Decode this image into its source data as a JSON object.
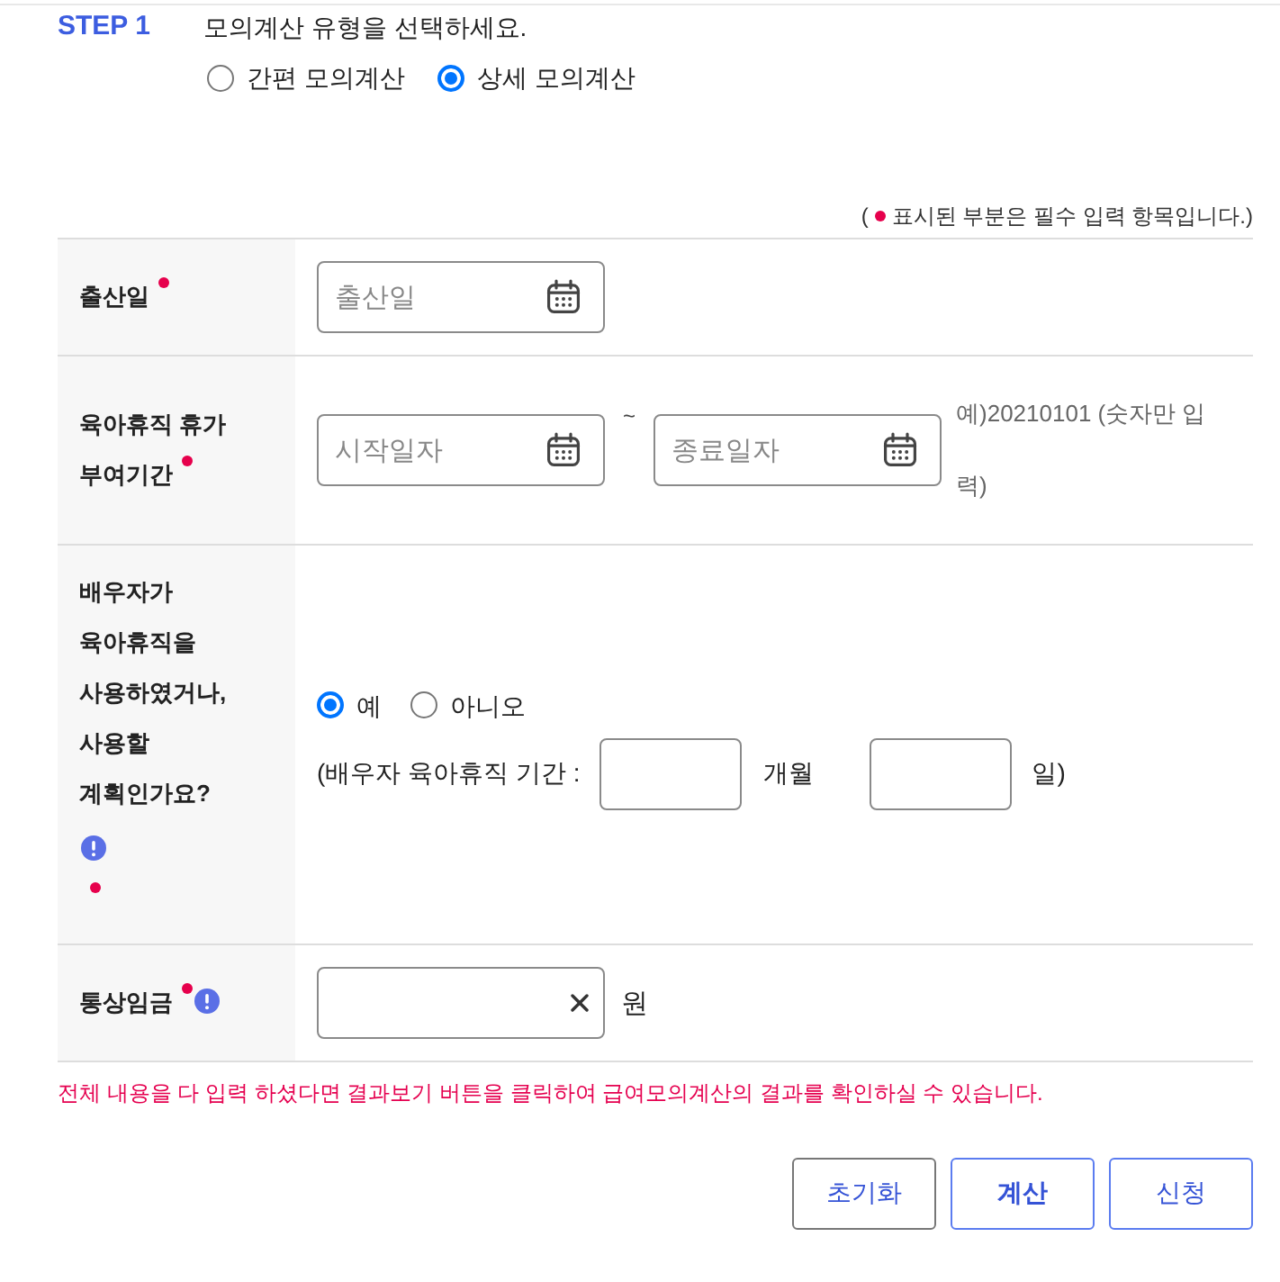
{
  "step": {
    "label": "STEP 1",
    "instruction": "모의계산 유형을 선택하세요.",
    "options": [
      {
        "label": "간편 모의계산",
        "selected": false
      },
      {
        "label": "상세 모의계산",
        "selected": true
      }
    ]
  },
  "required_note": {
    "open": "(",
    "text": "표시된 부분은 필수 입력 항목입니다.)"
  },
  "fields": [
    {
      "kind": "date",
      "label": "출산일",
      "required": true,
      "info": false,
      "placeholder": "출산일"
    },
    {
      "kind": "date_range",
      "label": "육아휴직 휴가 부여기간",
      "required": true,
      "info": false,
      "start": {
        "placeholder": "시작일자"
      },
      "separator": "~",
      "end": {
        "placeholder": "종료일자"
      },
      "hint": "예)20210101 (숫자만 입력)"
    },
    {
      "kind": "choice_period",
      "label": "배우자가 육아휴직을 사용하였거나, 사용할 계획인가요?",
      "required": true,
      "info": true,
      "options": [
        {
          "label": "예",
          "selected": true
        },
        {
          "label": "아니오",
          "selected": false
        }
      ],
      "period": {
        "prefix": "(배우자 육아휴직 기간 :",
        "months_unit": "개월",
        "days_unit": "일)"
      }
    },
    {
      "kind": "amount",
      "label": "통상임금",
      "required": true,
      "info": true,
      "unit": "원"
    }
  ],
  "message": "전체 내용을 다 입력 하셨다면 결과보기 버튼을 클릭하여 급여모의계산의 결과를 확인하실 수 있습니다.",
  "buttons": [
    {
      "label": "초기화",
      "kind": "reset"
    },
    {
      "label": "계산",
      "kind": "primary"
    },
    {
      "label": "신청",
      "kind": "default"
    }
  ]
}
